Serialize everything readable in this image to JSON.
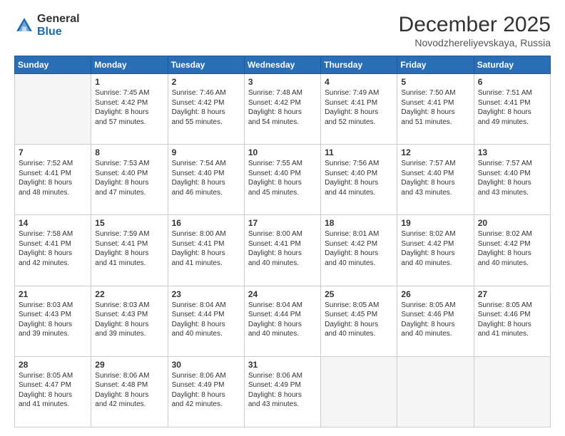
{
  "logo": {
    "general": "General",
    "blue": "Blue"
  },
  "header": {
    "month": "December 2025",
    "location": "Novodzhereliyevskaya, Russia"
  },
  "days": [
    "Sunday",
    "Monday",
    "Tuesday",
    "Wednesday",
    "Thursday",
    "Friday",
    "Saturday"
  ],
  "weeks": [
    [
      {
        "day": "",
        "empty": true
      },
      {
        "day": "1",
        "line1": "Sunrise: 7:45 AM",
        "line2": "Sunset: 4:42 PM",
        "line3": "Daylight: 8 hours",
        "line4": "and 57 minutes."
      },
      {
        "day": "2",
        "line1": "Sunrise: 7:46 AM",
        "line2": "Sunset: 4:42 PM",
        "line3": "Daylight: 8 hours",
        "line4": "and 55 minutes."
      },
      {
        "day": "3",
        "line1": "Sunrise: 7:48 AM",
        "line2": "Sunset: 4:42 PM",
        "line3": "Daylight: 8 hours",
        "line4": "and 54 minutes."
      },
      {
        "day": "4",
        "line1": "Sunrise: 7:49 AM",
        "line2": "Sunset: 4:41 PM",
        "line3": "Daylight: 8 hours",
        "line4": "and 52 minutes."
      },
      {
        "day": "5",
        "line1": "Sunrise: 7:50 AM",
        "line2": "Sunset: 4:41 PM",
        "line3": "Daylight: 8 hours",
        "line4": "and 51 minutes."
      },
      {
        "day": "6",
        "line1": "Sunrise: 7:51 AM",
        "line2": "Sunset: 4:41 PM",
        "line3": "Daylight: 8 hours",
        "line4": "and 49 minutes."
      }
    ],
    [
      {
        "day": "7",
        "line1": "Sunrise: 7:52 AM",
        "line2": "Sunset: 4:41 PM",
        "line3": "Daylight: 8 hours",
        "line4": "and 48 minutes."
      },
      {
        "day": "8",
        "line1": "Sunrise: 7:53 AM",
        "line2": "Sunset: 4:40 PM",
        "line3": "Daylight: 8 hours",
        "line4": "and 47 minutes."
      },
      {
        "day": "9",
        "line1": "Sunrise: 7:54 AM",
        "line2": "Sunset: 4:40 PM",
        "line3": "Daylight: 8 hours",
        "line4": "and 46 minutes."
      },
      {
        "day": "10",
        "line1": "Sunrise: 7:55 AM",
        "line2": "Sunset: 4:40 PM",
        "line3": "Daylight: 8 hours",
        "line4": "and 45 minutes."
      },
      {
        "day": "11",
        "line1": "Sunrise: 7:56 AM",
        "line2": "Sunset: 4:40 PM",
        "line3": "Daylight: 8 hours",
        "line4": "and 44 minutes."
      },
      {
        "day": "12",
        "line1": "Sunrise: 7:57 AM",
        "line2": "Sunset: 4:40 PM",
        "line3": "Daylight: 8 hours",
        "line4": "and 43 minutes."
      },
      {
        "day": "13",
        "line1": "Sunrise: 7:57 AM",
        "line2": "Sunset: 4:40 PM",
        "line3": "Daylight: 8 hours",
        "line4": "and 43 minutes."
      }
    ],
    [
      {
        "day": "14",
        "line1": "Sunrise: 7:58 AM",
        "line2": "Sunset: 4:41 PM",
        "line3": "Daylight: 8 hours",
        "line4": "and 42 minutes."
      },
      {
        "day": "15",
        "line1": "Sunrise: 7:59 AM",
        "line2": "Sunset: 4:41 PM",
        "line3": "Daylight: 8 hours",
        "line4": "and 41 minutes."
      },
      {
        "day": "16",
        "line1": "Sunrise: 8:00 AM",
        "line2": "Sunset: 4:41 PM",
        "line3": "Daylight: 8 hours",
        "line4": "and 41 minutes."
      },
      {
        "day": "17",
        "line1": "Sunrise: 8:00 AM",
        "line2": "Sunset: 4:41 PM",
        "line3": "Daylight: 8 hours",
        "line4": "and 40 minutes."
      },
      {
        "day": "18",
        "line1": "Sunrise: 8:01 AM",
        "line2": "Sunset: 4:42 PM",
        "line3": "Daylight: 8 hours",
        "line4": "and 40 minutes."
      },
      {
        "day": "19",
        "line1": "Sunrise: 8:02 AM",
        "line2": "Sunset: 4:42 PM",
        "line3": "Daylight: 8 hours",
        "line4": "and 40 minutes."
      },
      {
        "day": "20",
        "line1": "Sunrise: 8:02 AM",
        "line2": "Sunset: 4:42 PM",
        "line3": "Daylight: 8 hours",
        "line4": "and 40 minutes."
      }
    ],
    [
      {
        "day": "21",
        "line1": "Sunrise: 8:03 AM",
        "line2": "Sunset: 4:43 PM",
        "line3": "Daylight: 8 hours",
        "line4": "and 39 minutes."
      },
      {
        "day": "22",
        "line1": "Sunrise: 8:03 AM",
        "line2": "Sunset: 4:43 PM",
        "line3": "Daylight: 8 hours",
        "line4": "and 39 minutes."
      },
      {
        "day": "23",
        "line1": "Sunrise: 8:04 AM",
        "line2": "Sunset: 4:44 PM",
        "line3": "Daylight: 8 hours",
        "line4": "and 40 minutes."
      },
      {
        "day": "24",
        "line1": "Sunrise: 8:04 AM",
        "line2": "Sunset: 4:44 PM",
        "line3": "Daylight: 8 hours",
        "line4": "and 40 minutes."
      },
      {
        "day": "25",
        "line1": "Sunrise: 8:05 AM",
        "line2": "Sunset: 4:45 PM",
        "line3": "Daylight: 8 hours",
        "line4": "and 40 minutes."
      },
      {
        "day": "26",
        "line1": "Sunrise: 8:05 AM",
        "line2": "Sunset: 4:46 PM",
        "line3": "Daylight: 8 hours",
        "line4": "and 40 minutes."
      },
      {
        "day": "27",
        "line1": "Sunrise: 8:05 AM",
        "line2": "Sunset: 4:46 PM",
        "line3": "Daylight: 8 hours",
        "line4": "and 41 minutes."
      }
    ],
    [
      {
        "day": "28",
        "line1": "Sunrise: 8:05 AM",
        "line2": "Sunset: 4:47 PM",
        "line3": "Daylight: 8 hours",
        "line4": "and 41 minutes."
      },
      {
        "day": "29",
        "line1": "Sunrise: 8:06 AM",
        "line2": "Sunset: 4:48 PM",
        "line3": "Daylight: 8 hours",
        "line4": "and 42 minutes."
      },
      {
        "day": "30",
        "line1": "Sunrise: 8:06 AM",
        "line2": "Sunset: 4:49 PM",
        "line3": "Daylight: 8 hours",
        "line4": "and 42 minutes."
      },
      {
        "day": "31",
        "line1": "Sunrise: 8:06 AM",
        "line2": "Sunset: 4:49 PM",
        "line3": "Daylight: 8 hours",
        "line4": "and 43 minutes."
      },
      {
        "day": "",
        "empty": true
      },
      {
        "day": "",
        "empty": true
      },
      {
        "day": "",
        "empty": true
      }
    ]
  ]
}
